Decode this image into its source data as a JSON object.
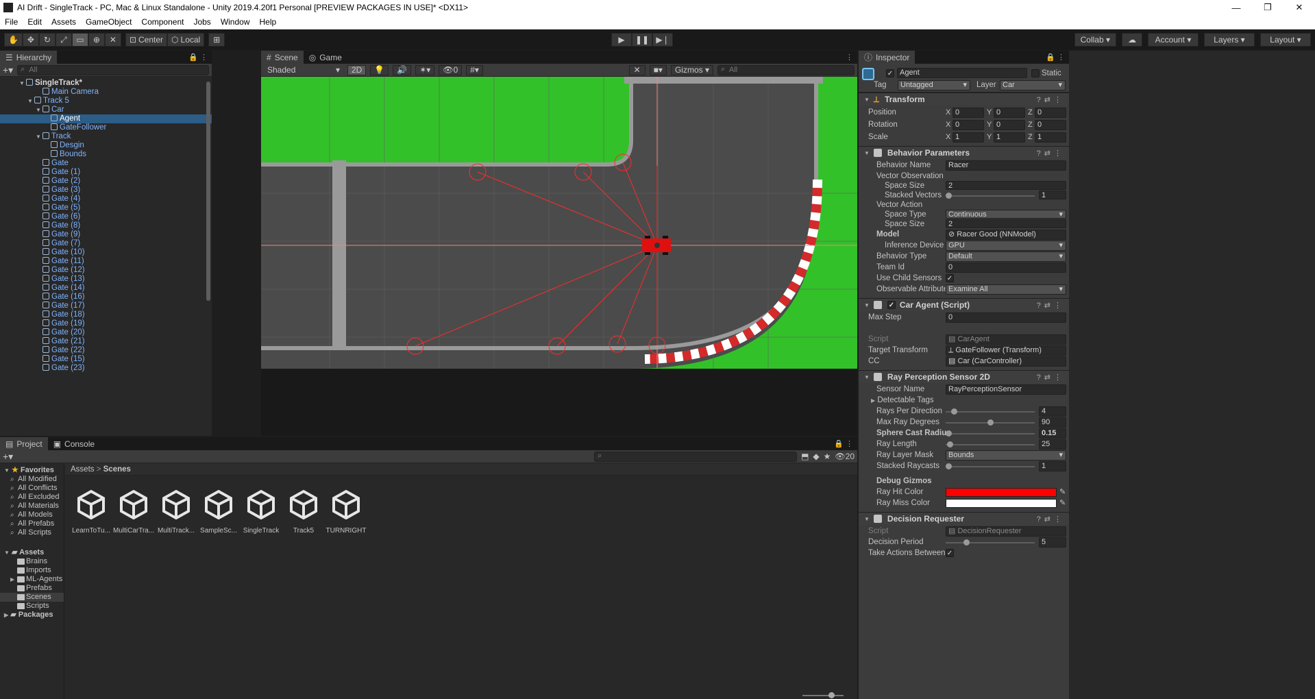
{
  "window": {
    "title": "AI Drift - SingleTrack - PC, Mac & Linux Standalone - Unity 2019.4.20f1 Personal [PREVIEW PACKAGES IN USE]* <DX11>",
    "minimize": "—",
    "maximize": "❐",
    "close": "✕"
  },
  "menu": [
    "File",
    "Edit",
    "Assets",
    "GameObject",
    "Component",
    "Jobs",
    "Window",
    "Help"
  ],
  "toolbar": {
    "tools": [
      "hand-tool",
      "move-tool",
      "rotate-tool",
      "scale-tool",
      "rect-tool",
      "transform-tool",
      "custom-tool"
    ],
    "pivot": "Center",
    "space": "Local",
    "collab": "Collab",
    "account": "Account",
    "layers": "Layers",
    "layout": "Layout"
  },
  "hierarchy": {
    "tab": "Hierarchy",
    "search_placeholder": "All",
    "rows": [
      {
        "label": "SingleTrack*",
        "indent": 0,
        "expand": "▼",
        "scene": true
      },
      {
        "label": "Main Camera",
        "indent": 2,
        "expand": ""
      },
      {
        "label": "Track 5",
        "indent": 1,
        "expand": "▼"
      },
      {
        "label": "Car",
        "indent": 2,
        "expand": "▼"
      },
      {
        "label": "Agent",
        "indent": 3,
        "expand": "",
        "selected": true
      },
      {
        "label": "GateFollower",
        "indent": 3,
        "expand": ""
      },
      {
        "label": "Track",
        "indent": 2,
        "expand": "▼"
      },
      {
        "label": "Desgin",
        "indent": 3,
        "expand": ""
      },
      {
        "label": "Bounds",
        "indent": 3,
        "expand": ""
      },
      {
        "label": "Gate",
        "indent": 2,
        "expand": ""
      },
      {
        "label": "Gate (1)",
        "indent": 2,
        "expand": ""
      },
      {
        "label": "Gate (2)",
        "indent": 2,
        "expand": ""
      },
      {
        "label": "Gate (3)",
        "indent": 2,
        "expand": ""
      },
      {
        "label": "Gate (4)",
        "indent": 2,
        "expand": ""
      },
      {
        "label": "Gate (5)",
        "indent": 2,
        "expand": ""
      },
      {
        "label": "Gate (6)",
        "indent": 2,
        "expand": ""
      },
      {
        "label": "Gate (8)",
        "indent": 2,
        "expand": ""
      },
      {
        "label": "Gate (9)",
        "indent": 2,
        "expand": ""
      },
      {
        "label": "Gate (7)",
        "indent": 2,
        "expand": ""
      },
      {
        "label": "Gate (10)",
        "indent": 2,
        "expand": ""
      },
      {
        "label": "Gate (11)",
        "indent": 2,
        "expand": ""
      },
      {
        "label": "Gate (12)",
        "indent": 2,
        "expand": ""
      },
      {
        "label": "Gate (13)",
        "indent": 2,
        "expand": ""
      },
      {
        "label": "Gate (14)",
        "indent": 2,
        "expand": ""
      },
      {
        "label": "Gate (16)",
        "indent": 2,
        "expand": ""
      },
      {
        "label": "Gate (17)",
        "indent": 2,
        "expand": ""
      },
      {
        "label": "Gate (18)",
        "indent": 2,
        "expand": ""
      },
      {
        "label": "Gate (19)",
        "indent": 2,
        "expand": ""
      },
      {
        "label": "Gate (20)",
        "indent": 2,
        "expand": ""
      },
      {
        "label": "Gate (21)",
        "indent": 2,
        "expand": ""
      },
      {
        "label": "Gate (22)",
        "indent": 2,
        "expand": ""
      },
      {
        "label": "Gate (15)",
        "indent": 2,
        "expand": ""
      },
      {
        "label": "Gate (23)",
        "indent": 2,
        "expand": ""
      }
    ]
  },
  "scene": {
    "tabs": [
      "Scene",
      "Game"
    ],
    "shading": "Shaded",
    "mode_2d": "2D",
    "hidden_count": "0",
    "gizmos": "Gizmos",
    "search_placeholder": "All"
  },
  "project": {
    "tabs": [
      "Project",
      "Console"
    ],
    "hidden_count": "20",
    "breadcrumb": [
      "Assets",
      "Scenes"
    ],
    "favorites_label": "Favorites",
    "favorites": [
      "All Modified",
      "All Conflicts",
      "All Excluded",
      "All Materials",
      "All Models",
      "All Prefabs",
      "All Scripts"
    ],
    "assets_label": "Assets",
    "asset_folders": [
      "Brains",
      "Imports",
      "ML-Agents",
      "Prefabs",
      "Scenes",
      "Scripts"
    ],
    "packages_label": "Packages",
    "files": [
      "LearnToTu...",
      "MultiCarTra...",
      "MultiTrack...",
      "SampleSc...",
      "SingleTrack",
      "Track5",
      "TURNRIGHT"
    ]
  },
  "inspector": {
    "tab": "Inspector",
    "object_name": "Agent",
    "static_label": "Static",
    "tag_label": "Tag",
    "tag": "Untagged",
    "layer_label": "Layer",
    "layer": "Car",
    "transform": {
      "title": "Transform",
      "position_label": "Position",
      "position": [
        "0",
        "0",
        "0"
      ],
      "rotation_label": "Rotation",
      "rotation": [
        "0",
        "0",
        "0"
      ],
      "scale_label": "Scale",
      "scale": [
        "1",
        "1",
        "1"
      ]
    },
    "behavior": {
      "title": "Behavior Parameters",
      "behavior_name_label": "Behavior Name",
      "behavior_name": "Racer",
      "vector_obs_label": "Vector Observation",
      "space_size_label": "Space Size",
      "obs_space_size": "2",
      "stacked_vectors_label": "Stacked Vectors",
      "stacked_vectors": "1",
      "vector_action_label": "Vector Action",
      "space_type_label": "Space Type",
      "space_type": "Continuous",
      "action_space_size": "2",
      "model_label": "Model",
      "model": "Racer Good (NNModel)",
      "inference_device_label": "Inference Device",
      "inference_device": "GPU",
      "behavior_type_label": "Behavior Type",
      "behavior_type": "Default",
      "team_id_label": "Team Id",
      "team_id": "0",
      "use_child_sensors_label": "Use Child Sensors",
      "observable_attribute_label": "Observable Attribute",
      "observable_attribute": "Examine All"
    },
    "car_agent": {
      "title": "Car Agent (Script)",
      "max_step_label": "Max Step",
      "max_step": "0",
      "script_label": "Script",
      "script": "CarAgent",
      "target_transform_label": "Target Transform",
      "target_transform": "GateFollower (Transform)",
      "cc_label": "CC",
      "cc": "Car (CarController)"
    },
    "ray_sensor": {
      "title": "Ray Perception Sensor 2D",
      "sensor_name_label": "Sensor Name",
      "sensor_name": "RayPerceptionSensor",
      "detectable_tags_label": "Detectable Tags",
      "rays_per_direction_label": "Rays Per Direction",
      "rays_per_direction": "4",
      "max_ray_degrees_label": "Max Ray Degrees",
      "max_ray_degrees": "90",
      "sphere_cast_radius_label": "Sphere Cast Radius",
      "sphere_cast_radius": "0.15",
      "ray_length_label": "Ray Length",
      "ray_length": "25",
      "ray_layer_mask_label": "Ray Layer Mask",
      "ray_layer_mask": "Bounds",
      "stacked_raycasts_label": "Stacked Raycasts",
      "stacked_raycasts": "1",
      "debug_gizmos_label": "Debug Gizmos",
      "ray_hit_color_label": "Ray Hit Color",
      "ray_hit_color": "#ff0000",
      "ray_miss_color_label": "Ray Miss Color",
      "ray_miss_color": "#ffffff"
    },
    "decision_requester": {
      "title": "Decision Requester",
      "script_label": "Script",
      "script": "DecisionRequester",
      "decision_period_label": "Decision Period",
      "decision_period": "5",
      "take_actions_label": "Take Actions Between D"
    }
  },
  "colors": {
    "accent_selection": "#2c5d87",
    "grass": "#33c12a",
    "track": "#4b4b4b",
    "ray": "#ff2a2a"
  }
}
